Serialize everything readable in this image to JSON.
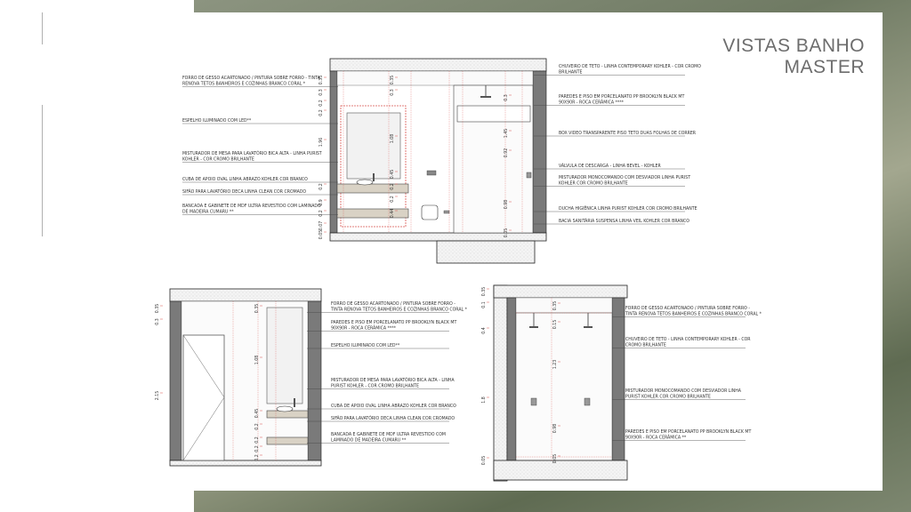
{
  "title": {
    "line1": "VISTAS BANHO",
    "line2": "MASTER"
  },
  "elevation_top": {
    "left_labels": [
      {
        "lines": [
          "FORRO DE GESSO ACARTONADO / PINTURA SOBRE FORRO - TINTA",
          "RENOVA TETOS BANHEIROS E COZINHAS BRANCO CORAL *"
        ]
      },
      {
        "lines": [
          "ESPELHO ILUMINADO COM LED**"
        ]
      },
      {
        "lines": [
          "MISTURADOR DE MESA PARA LAVATÓRIO BICA ALTA - LINHA PURIST",
          "KOHLER - COR CROMO BRILHANTE"
        ]
      },
      {
        "lines": [
          "CUBA DE APOIO OVAL LINHA ABRAZO KOHLER COR BRANCO"
        ]
      },
      {
        "lines": [
          "SIFÃO PARA LAVATÓRIO DECA LINHA CLEAN COR CROMADO"
        ]
      },
      {
        "lines": [
          "BANCADA E GABINETE DE MDF ULTRA REVESTIDO COM LAMINADO",
          "DE MADEIRA CUMARU **"
        ]
      }
    ],
    "right_labels": [
      {
        "lines": [
          "CHUVEIRO DE TETO - LINHA CONTEMPORARY KOHLER - COR CROMO",
          "BRILHANTE"
        ]
      },
      {
        "lines": [
          "PAREDES E PISO EM PORCELANATO PP BROOKLYN BLACK MT",
          "90X90R - ROCA CERÂMICA ****"
        ]
      },
      {
        "lines": [
          "BOX VIDEO TRANSPARENTE PISO TETO DUAS FOLHAS DE CORRER"
        ]
      },
      {
        "lines": [
          "VÁLVULA DE DESCARGA - LINHA BEVEL - KOHLER"
        ]
      },
      {
        "lines": [
          "MISTURADOR MONOCOMANDO COM DESVIADOR LINHA PURIST",
          "KOHLER COR CROMO BRILHANTE"
        ]
      },
      {
        "lines": [
          "DUCHA HIGIÊNICA LINHA PURIST KOHLER COR CROMO BRILHANTE"
        ]
      },
      {
        "lines": [
          "BACIA SANITÁRIA SUSPENSA LINHA VEIL KOHLER COR BRANCO"
        ]
      }
    ],
    "dims_left": [
      "0.35",
      "0.3",
      "0.2",
      "0.2",
      "1.96",
      "0.2",
      "0.9",
      "0.2",
      "0.07",
      "0.05"
    ],
    "dims_inner": [
      "0.35",
      "0.3",
      "1.08",
      "0.45",
      "0.2",
      "0.2",
      "0.44"
    ],
    "dims_right": [
      "0.3",
      "1.45",
      "0.92",
      "0.98",
      "0.05"
    ]
  },
  "elevation_bl": {
    "labels": [
      {
        "lines": [
          "FORRO DE GESSO ACARTONADO / PINTURA SOBRE FORRO -",
          "TINTA RENOVA TETOS BANHEIROS E COZINHAS BRANCO CORAL *"
        ]
      },
      {
        "lines": [
          "PAREDES E PISO EM PORCELANATO PP BROOKLYN BLACK MT",
          "90X90R - ROCA CERÂMICA ****"
        ]
      },
      {
        "lines": [
          "ESPELHO ILUMINADO COM LED**"
        ]
      },
      {
        "lines": [
          "MISTURADOR DE MESA PARA LAVATÓRIO BICA ALTA - LINHA",
          "PURIST KOHLER - COR CROMO BRILHANTE"
        ]
      },
      {
        "lines": [
          "CUBA DE APOIO OVAL LINHA ABRAZO KOHLER COR BRANCO"
        ]
      },
      {
        "lines": [
          "SIFÃO PARA LAVATÓRIO DECA LINHA CLEAN COR CROMADO"
        ]
      },
      {
        "lines": [
          "BANCADA E GABINETE DE MDF ULTRA REVESTIDO COM",
          "LAMINADO DE MADEIRA CUMARU **"
        ]
      }
    ],
    "dims_outer": [
      "0.35",
      "0.3",
      "2.15"
    ],
    "dims_inner": [
      "0.35",
      "1.08",
      "0.45",
      "0.2",
      "0.2",
      "0.2",
      "0.2"
    ]
  },
  "elevation_br": {
    "labels": [
      {
        "lines": [
          "FORRO DE GESSO ACARTONADO / PINTURA SOBRE FORRO -",
          "TINTA RENOVA TETOS BANHEIROS E COZINHAS BRANCO CORAL *"
        ]
      },
      {
        "lines": [
          "CHUVEIRO DE TETO - LINHA CONTEMPORARY KOHLER - COR",
          "CROMO BRILHANTE"
        ]
      },
      {
        "lines": [
          "MISTURADOR MONOCOMANDO COM DESVIADOR LINHA",
          "PURIST KOHLER COR CROMO BRILHANTE"
        ]
      },
      {
        "lines": [
          "PAREDES E PISO EM PORCELANATO PP BROOKLYN BLACK MT",
          "90X90R - ROCA CERÂMICA **"
        ]
      }
    ],
    "dims_outer": [
      "0.35",
      "0.1",
      "0.4",
      "1.8",
      "0.05"
    ],
    "dims_inner": [
      "0.35",
      "0.15",
      "1.23",
      "0.98",
      "0.05"
    ]
  }
}
